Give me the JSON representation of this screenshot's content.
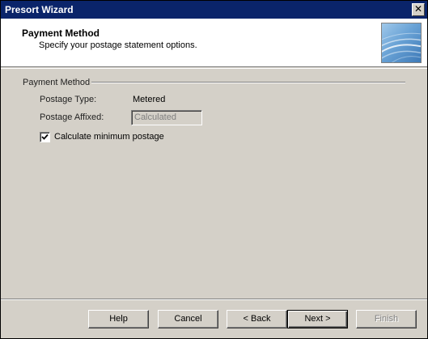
{
  "window": {
    "title": "Presort Wizard",
    "close_glyph": "✕"
  },
  "header": {
    "title": "Payment Method",
    "subtitle": "Specify your postage statement options."
  },
  "group": {
    "label": "Payment Method"
  },
  "fields": {
    "postage_type_label": "Postage Type:",
    "postage_type_value": "Metered",
    "postage_affixed_label": "Postage Affixed:",
    "postage_affixed_value": "Calculated"
  },
  "checkbox": {
    "label": "Calculate minimum postage",
    "checked": true
  },
  "buttons": {
    "help": "Help",
    "cancel": "Cancel",
    "back": "< Back",
    "next": "Next >",
    "finish": "Finish"
  }
}
